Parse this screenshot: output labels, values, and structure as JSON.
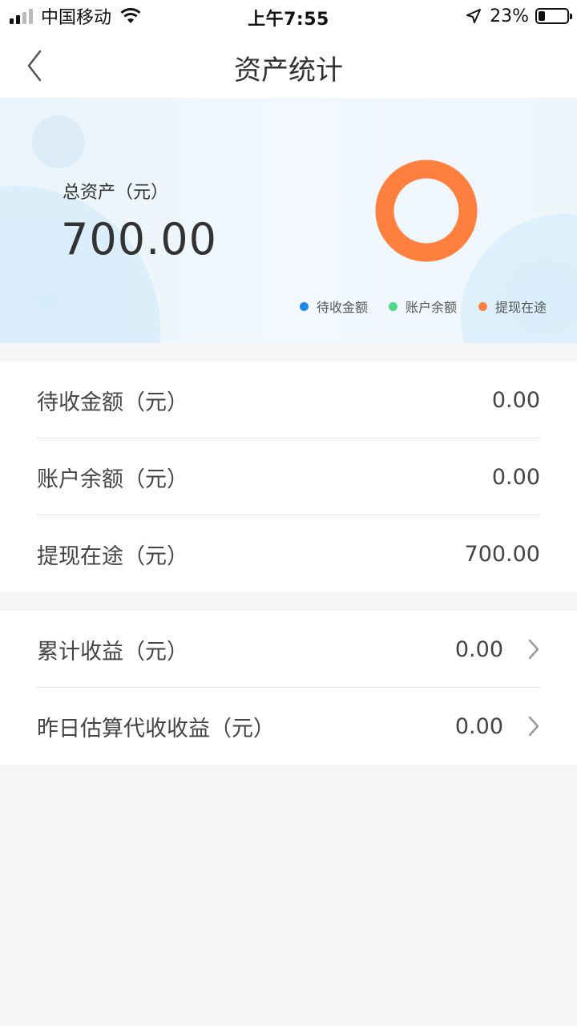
{
  "status_bar": {
    "carrier": "中国移动",
    "time": "上午7:55",
    "battery_percent": "23%",
    "battery_level": 0.23
  },
  "nav": {
    "title": "资产统计"
  },
  "summary": {
    "label": "总资产（元）",
    "value": "700.00",
    "legend": [
      {
        "label": "待收金额",
        "color": "#1e88e5"
      },
      {
        "label": "账户余额",
        "color": "#4cd98a"
      },
      {
        "label": "提现在途",
        "color": "#ff7f3f"
      }
    ]
  },
  "chart_data": {
    "type": "pie",
    "categories": [
      "待收金额",
      "账户余额",
      "提现在途"
    ],
    "values": [
      0,
      0,
      700
    ],
    "colors": [
      "#1e88e5",
      "#4cd98a",
      "#ff7f3f"
    ]
  },
  "assets": [
    {
      "label": "待收金额（元）",
      "value": "0.00"
    },
    {
      "label": "账户余额（元）",
      "value": "0.00"
    },
    {
      "label": "提现在途（元）",
      "value": "700.00"
    }
  ],
  "earnings": [
    {
      "label": "累计收益（元）",
      "value": "0.00"
    },
    {
      "label": "昨日估算代收收益（元）",
      "value": "0.00"
    }
  ]
}
